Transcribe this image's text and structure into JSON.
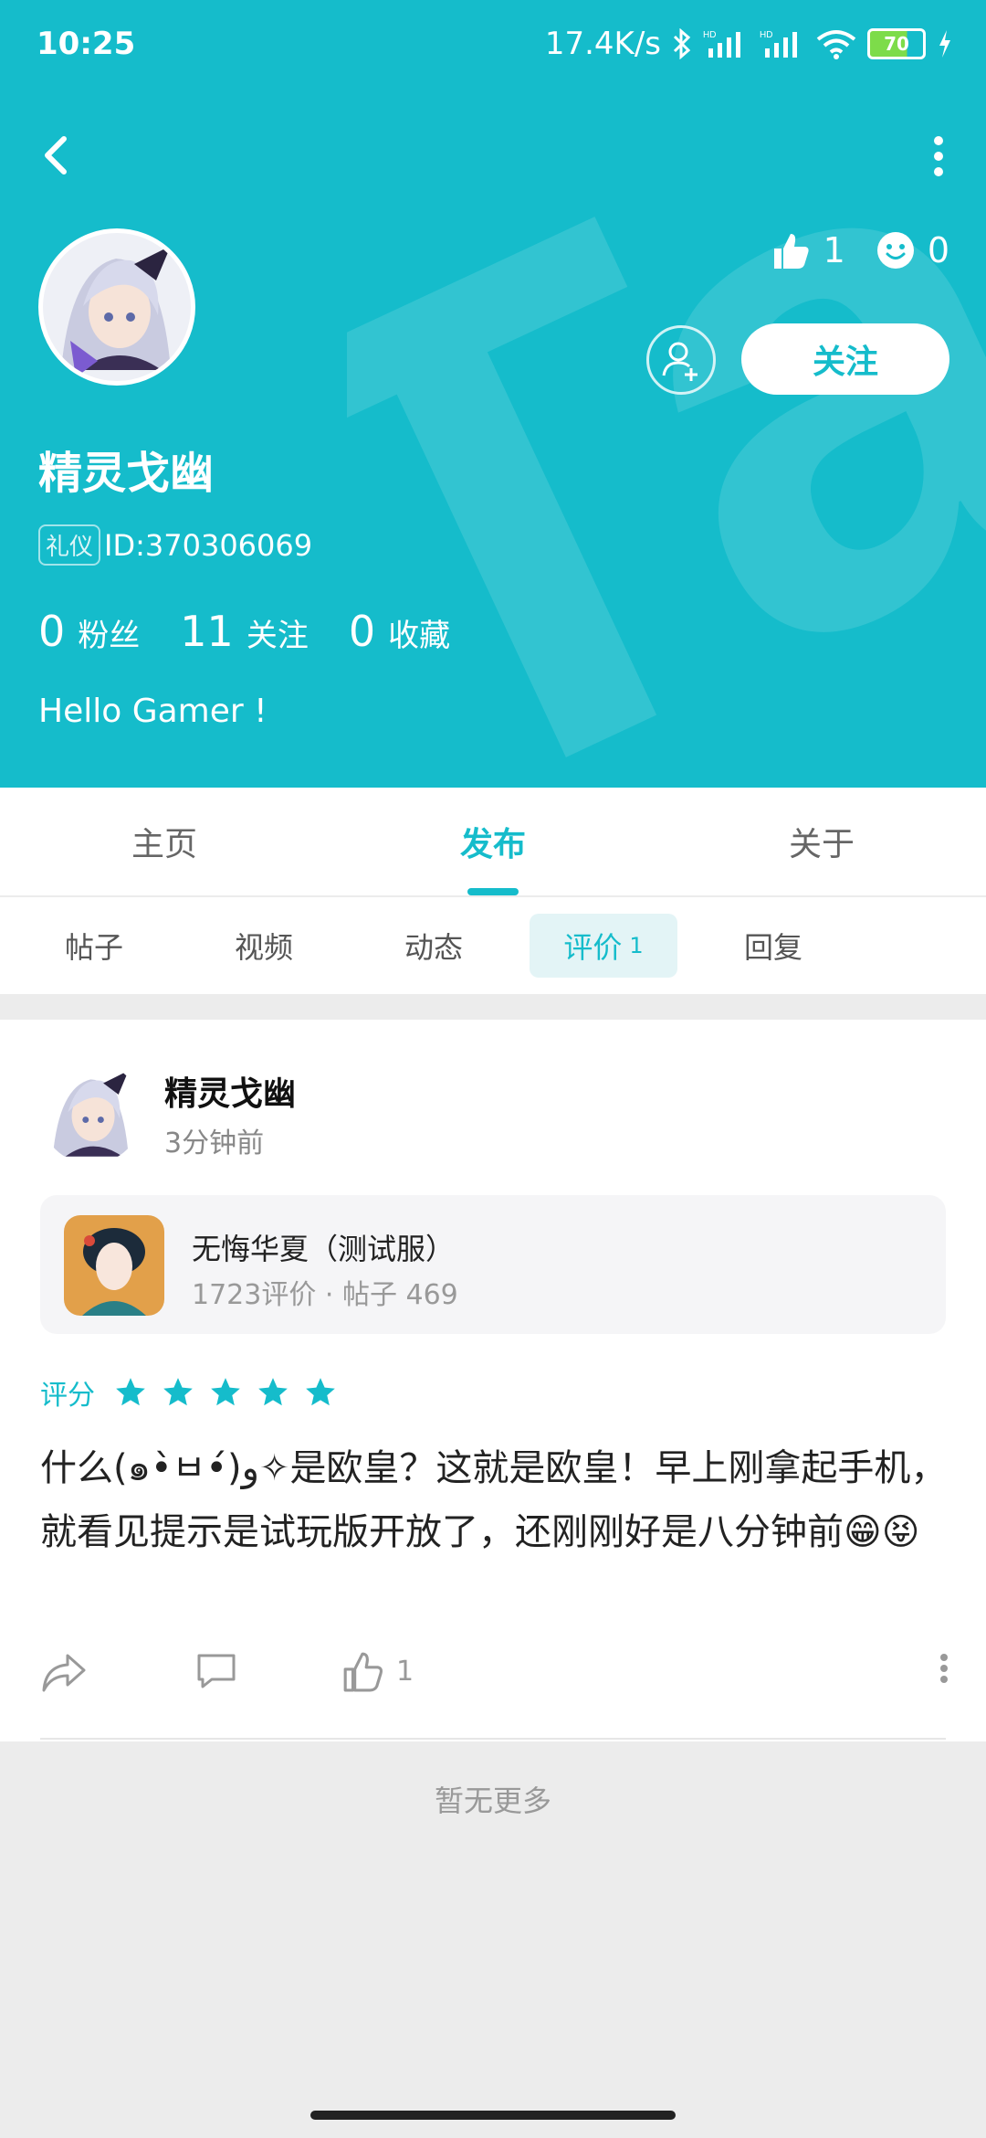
{
  "status_bar": {
    "time": "10:25",
    "speed": "17.4K/s",
    "battery": "70",
    "icons": [
      "bluetooth-icon",
      "signal-hd-icon",
      "signal-hd-icon",
      "wifi-icon",
      "battery-icon",
      "charging-icon"
    ]
  },
  "header": {
    "likes": "1",
    "smiles": "0",
    "follow_label": "关注",
    "username": "精灵戈幽",
    "tag": "礼仪",
    "id_text": "ID:370306069",
    "counts": [
      {
        "num": "0",
        "label": "粉丝"
      },
      {
        "num": "11",
        "label": "关注"
      },
      {
        "num": "0",
        "label": "收藏"
      }
    ],
    "bio": "Hello Gamer !",
    "bg_color": "#15bccb"
  },
  "tabs": [
    {
      "label": "主页",
      "active": false
    },
    {
      "label": "发布",
      "active": true
    },
    {
      "label": "关于",
      "active": false
    }
  ],
  "subtabs": [
    {
      "label": "帖子",
      "count": ""
    },
    {
      "label": "视频",
      "count": ""
    },
    {
      "label": "动态",
      "count": ""
    },
    {
      "label": "评价",
      "count": "1"
    },
    {
      "label": "回复",
      "count": ""
    }
  ],
  "post": {
    "author": "精灵戈幽",
    "time": "3分钟前",
    "game": {
      "title": "无悔华夏（测试服）",
      "meta": "1723评价 · 帖子 469"
    },
    "rating_label": "评分",
    "stars": 5,
    "content": "什么(๑•̀ㅂ•́)و✧是欧皇？这就是欧皇！早上刚拿起手机，就看见提示是试玩版开放了，还刚刚好是八分钟前😁😝",
    "like_count": "1"
  },
  "footer": {
    "no_more": "暂无更多"
  }
}
